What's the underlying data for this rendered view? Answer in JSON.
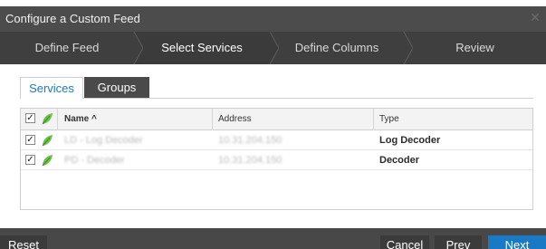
{
  "dialog": {
    "title": "Configure a Custom Feed"
  },
  "wizard": {
    "steps": [
      {
        "label": "Define Feed",
        "active": false
      },
      {
        "label": "Select Services",
        "active": true
      },
      {
        "label": "Define Columns",
        "active": false
      },
      {
        "label": "Review",
        "active": false
      }
    ]
  },
  "tabs": {
    "services": "Services",
    "groups": "Groups"
  },
  "grid": {
    "columns": {
      "name": "Name ^",
      "address": "Address",
      "type": "Type"
    },
    "rows": [
      {
        "name": "LD - Log Decoder",
        "address": "10.31.204.150",
        "type": "Log Decoder",
        "checked": true
      },
      {
        "name": "PD - Decoder",
        "address": "10.31.204.150",
        "type": "Decoder",
        "checked": true
      }
    ]
  },
  "footer": {
    "reset": "Reset",
    "cancel": "Cancel",
    "prev": "Prev",
    "next": "Next"
  },
  "colors": {
    "accent": "#1a79c4",
    "dark_bar": "#4a4a4a",
    "leaf_green": "#6cc24a"
  }
}
